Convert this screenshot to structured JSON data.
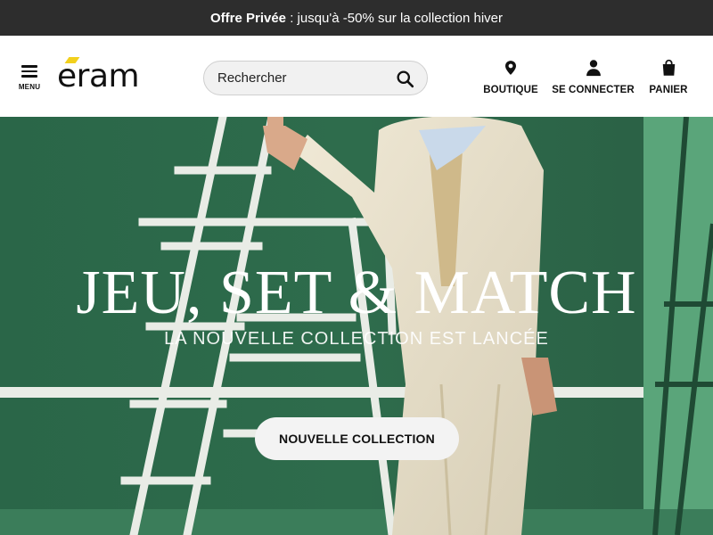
{
  "promo": {
    "strong": "Offre Privée",
    "text": " : jusqu'à -50% sur la collection hiver"
  },
  "header": {
    "menu_label": "MENU",
    "logo_text": "eram",
    "search": {
      "placeholder": "Rechercher",
      "value": ""
    },
    "actions": [
      {
        "label": "BOUTIQUE",
        "icon": "location-pin-icon"
      },
      {
        "label": "SE CONNECTER",
        "icon": "user-icon"
      },
      {
        "label": "PANIER",
        "icon": "shopping-bag-icon"
      }
    ]
  },
  "hero": {
    "title": "JEU, SET & MATCH",
    "subtitle": "LA NOUVELLE COLLECTION EST LANCÉE",
    "cta_label": "NOUVELLE COLLECTION"
  },
  "colors": {
    "promo_bg": "#2d2d2d",
    "brand_accent": "#f2d01c",
    "hero_green": "#2f6a4b"
  }
}
